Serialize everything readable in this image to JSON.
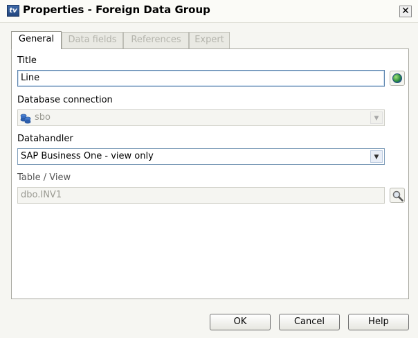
{
  "window": {
    "title": "Properties - Foreign Data Group",
    "app_icon_text": "tv"
  },
  "tabs": [
    {
      "label": "General",
      "active": true
    },
    {
      "label": "Data fields",
      "active": false
    },
    {
      "label": "References",
      "active": false
    },
    {
      "label": "Expert",
      "active": false
    }
  ],
  "general": {
    "title_label": "Title",
    "title_value": "Line",
    "db_label": "Database connection",
    "db_value": "sbo",
    "handler_label": "Datahandler",
    "handler_value": "SAP Business One - view only",
    "table_label": "Table / View",
    "table_value": "dbo.INV1"
  },
  "footer": {
    "ok": "OK",
    "cancel": "Cancel",
    "help": "Help"
  },
  "icons": {
    "app": "app-logo-icon",
    "close": "close-icon",
    "title_action": "globe-icon",
    "db": "database-icon",
    "table_action": "magnifier-icon"
  },
  "colors": {
    "accent_border": "#5b83ad",
    "disabled_text": "#9a9a92"
  }
}
